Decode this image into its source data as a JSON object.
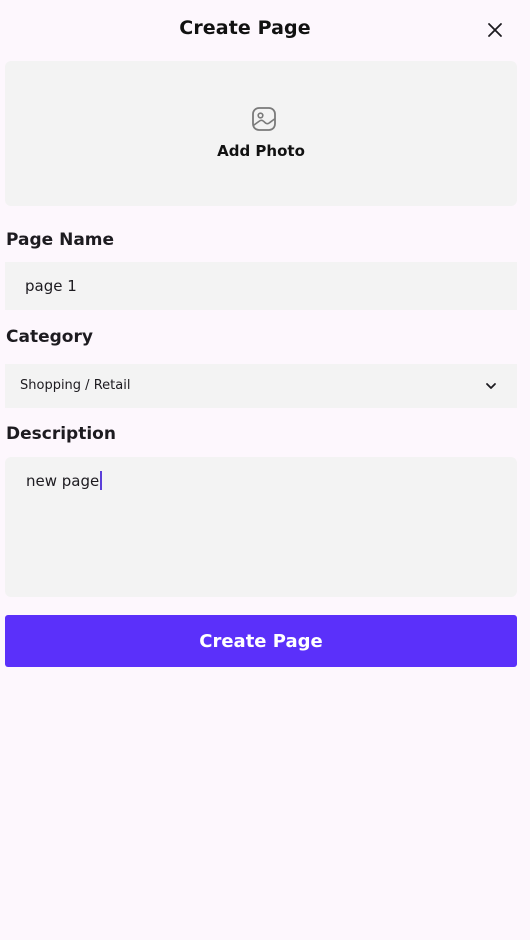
{
  "header": {
    "title": "Create Page",
    "close_icon": "close-icon"
  },
  "photo": {
    "label": "Add Photo",
    "icon": "image-icon"
  },
  "fields": {
    "name_label": "Page Name",
    "name_value": "page 1",
    "category_label": "Category",
    "category_value": "Shopping / Retail",
    "category_icon": "chevron-down-icon",
    "description_label": "Description",
    "description_value": "new page"
  },
  "actions": {
    "submit_label": "Create Page"
  },
  "colors": {
    "background": "#fdf7fd",
    "field_bg": "#f3f3f3",
    "primary": "#5b30fa",
    "caret": "#5b3fd9"
  }
}
